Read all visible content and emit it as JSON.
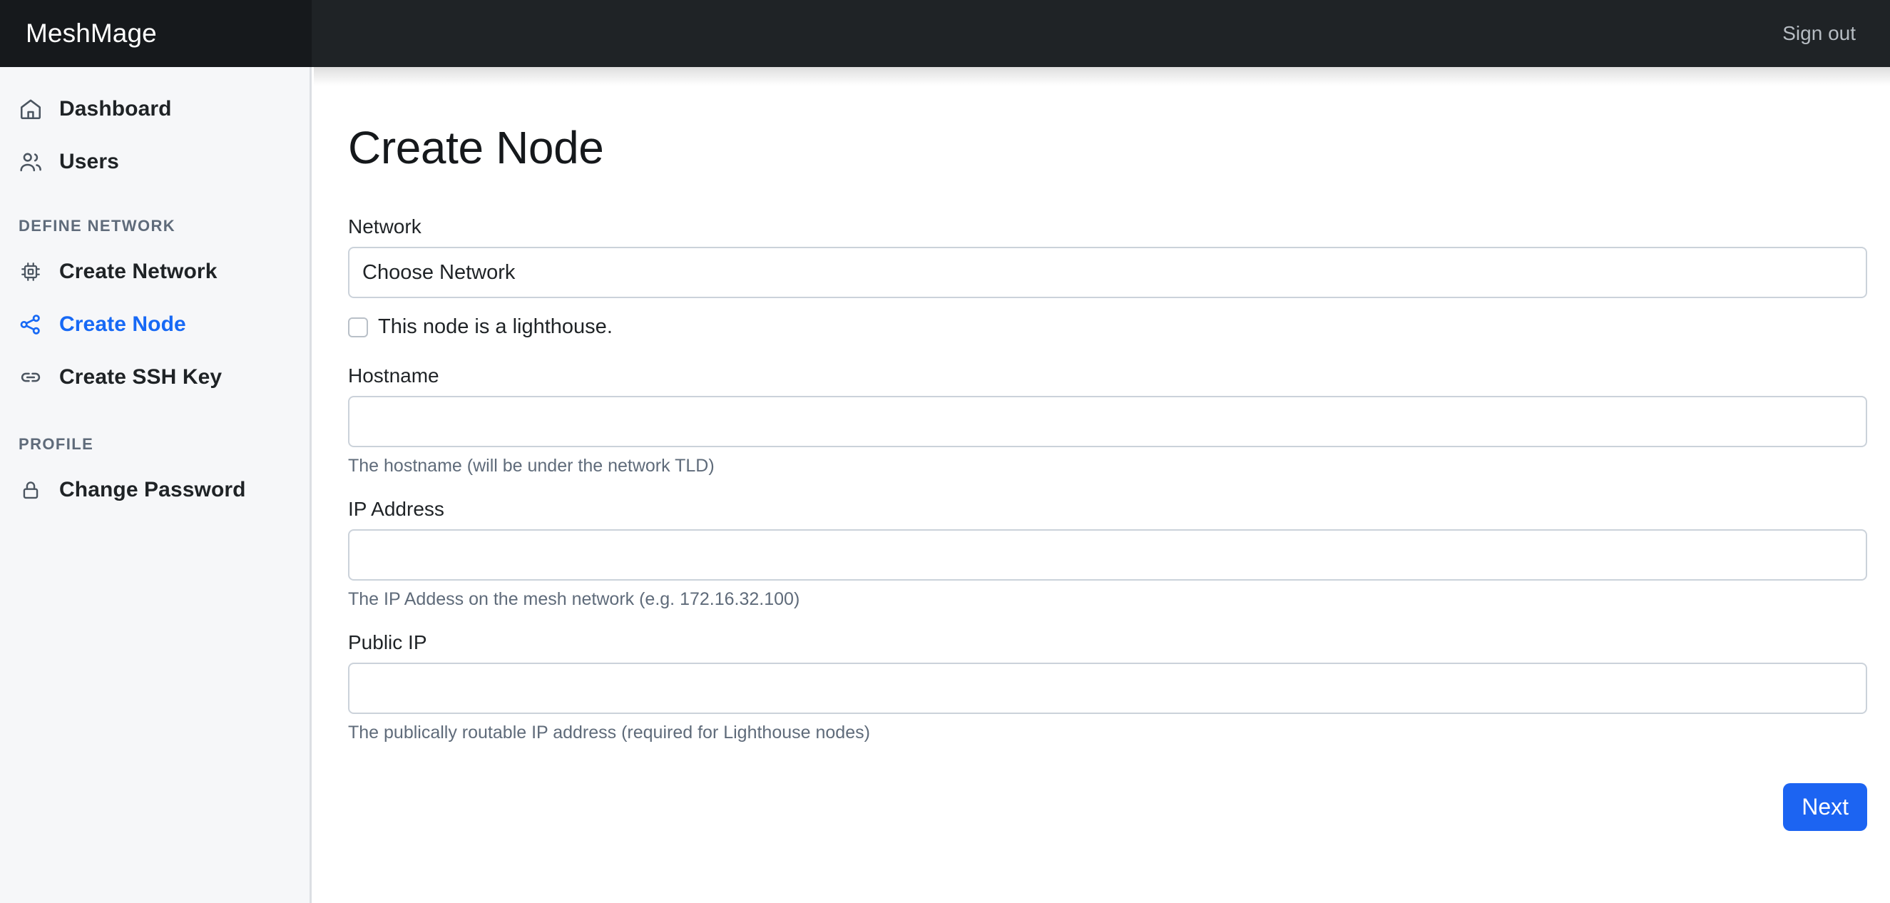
{
  "app": {
    "brand": "MeshMage",
    "signout_label": "Sign out"
  },
  "sidebar": {
    "primary_items": [
      {
        "label": "Dashboard",
        "icon": "home-icon",
        "active": false
      },
      {
        "label": "Users",
        "icon": "users-icon",
        "active": false
      }
    ],
    "sections": [
      {
        "title": "DEFINE NETWORK",
        "items": [
          {
            "label": "Create Network",
            "icon": "chip-icon",
            "active": false
          },
          {
            "label": "Create Node",
            "icon": "share-nodes-icon",
            "active": true
          },
          {
            "label": "Create SSH Key",
            "icon": "link-icon",
            "active": false
          }
        ]
      },
      {
        "title": "PROFILE",
        "items": [
          {
            "label": "Change Password",
            "icon": "lock-icon",
            "active": false
          }
        ]
      }
    ]
  },
  "main": {
    "title": "Create Node",
    "fields": {
      "network": {
        "label": "Network",
        "selected_option": "Choose Network",
        "options": [
          "Choose Network"
        ]
      },
      "lighthouse": {
        "label": "This node is a lighthouse.",
        "checked": false
      },
      "hostname": {
        "label": "Hostname",
        "value": "",
        "placeholder": "",
        "help": "The hostname (will be under the network TLD)"
      },
      "ip_address": {
        "label": "IP Address",
        "value": "",
        "placeholder": "",
        "help": "The IP Addess on the mesh network (e.g. 172.16.32.100)"
      },
      "public_ip": {
        "label": "Public IP",
        "value": "",
        "placeholder": "",
        "help": "The publically routable IP address (required for Lighthouse nodes)"
      }
    },
    "submit_label": "Next"
  },
  "colors": {
    "header_bg": "#1f2326",
    "sidebar_bg": "#f6f7f9",
    "accent": "#1769f5",
    "button": "#1c64f2",
    "border": "#cbd2da",
    "muted_text": "#5f6b7a"
  }
}
